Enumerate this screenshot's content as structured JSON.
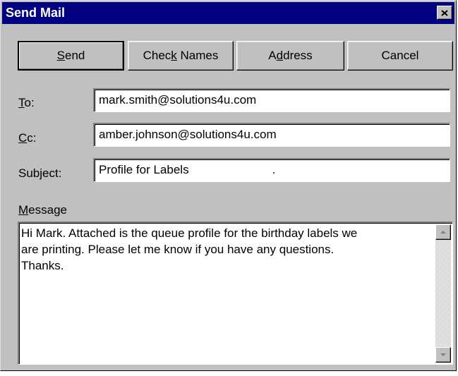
{
  "window": {
    "title": "Send Mail"
  },
  "buttons": [
    {
      "pre": "",
      "key": "S",
      "post": "end"
    },
    {
      "pre": "Chec",
      "key": "k",
      "post": " Names"
    },
    {
      "pre": "A",
      "key": "d",
      "post": "dress"
    },
    {
      "pre": "Cancel",
      "key": "",
      "post": ""
    }
  ],
  "fields": {
    "to": {
      "label_key": "T",
      "label_rest": "o:",
      "value": "mark.smith@solutions4u.com"
    },
    "cc": {
      "label_key": "C",
      "label_rest": "c:",
      "value": "amber.johnson@solutions4u.com"
    },
    "subject": {
      "label": "Subject:",
      "value": "Profile for Labels                         ."
    }
  },
  "message": {
    "label_key": "M",
    "label_rest": "essage",
    "lines": [
      "Hi Mark. Attached is the queue profile for the birthday labels we",
      "are printing. Please let me know if you have any questions.",
      "Thanks."
    ]
  },
  "icons": {
    "close": "close-icon",
    "scroll_up": "arrow-up-icon",
    "scroll_down": "arrow-down-icon"
  },
  "colors": {
    "titlebar": "#000080",
    "face": "#c0c0c0"
  }
}
